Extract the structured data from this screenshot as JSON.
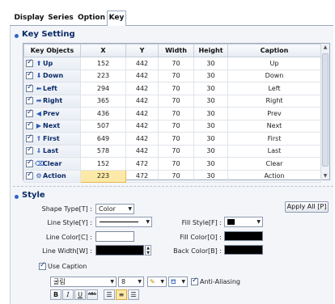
{
  "tabs": [
    {
      "label": "Display",
      "active": false
    },
    {
      "label": "Series",
      "active": false
    },
    {
      "label": "Option",
      "active": false
    },
    {
      "label": "Key",
      "active": true
    }
  ],
  "key_setting": {
    "title": "Key Setting",
    "columns": [
      "Key Objects",
      "X",
      "Y",
      "Width",
      "Height",
      "Caption"
    ],
    "rows": [
      {
        "icon": "arrow-up-icon",
        "name": "Up",
        "x": "152",
        "y": "442",
        "width": "70",
        "height": "30",
        "caption": "Up",
        "checked": true,
        "selected": false
      },
      {
        "icon": "arrow-down-icon",
        "name": "Down",
        "x": "223",
        "y": "442",
        "width": "70",
        "height": "30",
        "caption": "Down",
        "checked": true,
        "selected": false
      },
      {
        "icon": "arrow-left-icon",
        "name": "Left",
        "x": "294",
        "y": "442",
        "width": "70",
        "height": "30",
        "caption": "Left",
        "checked": true,
        "selected": false
      },
      {
        "icon": "arrow-right-icon",
        "name": "Right",
        "x": "365",
        "y": "442",
        "width": "70",
        "height": "30",
        "caption": "Right",
        "checked": true,
        "selected": false
      },
      {
        "icon": "prev-icon",
        "name": "Prev",
        "x": "436",
        "y": "442",
        "width": "70",
        "height": "30",
        "caption": "Prev",
        "checked": true,
        "selected": false
      },
      {
        "icon": "next-icon",
        "name": "Next",
        "x": "507",
        "y": "442",
        "width": "70",
        "height": "30",
        "caption": "Next",
        "checked": true,
        "selected": false
      },
      {
        "icon": "first-icon",
        "name": "First",
        "x": "649",
        "y": "442",
        "width": "70",
        "height": "30",
        "caption": "First",
        "checked": true,
        "selected": false
      },
      {
        "icon": "last-icon",
        "name": "Last",
        "x": "578",
        "y": "442",
        "width": "70",
        "height": "30",
        "caption": "Last",
        "checked": true,
        "selected": false
      },
      {
        "icon": "clear-icon",
        "name": "Clear",
        "x": "152",
        "y": "472",
        "width": "70",
        "height": "30",
        "caption": "Clear",
        "checked": true,
        "selected": false
      },
      {
        "icon": "action-icon",
        "name": "Action",
        "x": "223",
        "y": "472",
        "width": "70",
        "height": "30",
        "caption": "Action",
        "checked": true,
        "selected": true
      }
    ]
  },
  "style": {
    "title": "Style",
    "apply_all": "Apply All [P]",
    "shape_type_label": "Shape Type[T] :",
    "shape_type_value": "Color",
    "line_style_label": "Line Style[Y] :",
    "line_color_label": "Line Color[C] :",
    "line_color": "#ffffff",
    "line_width_label": "Line Width[W] :",
    "fill_style_label": "Fill Style[F] :",
    "fill_style_color": "#000000",
    "fill_color_label": "Fill Color[O] :",
    "fill_color": "#000000",
    "back_color_label": "Back Color[B] :",
    "back_color": "#000000",
    "use_caption_label": "Use Caption",
    "use_caption_checked": true,
    "font_name": "굴림",
    "font_size": "8",
    "anti_aliasing_label": "Anti-Aliasing",
    "anti_aliasing_checked": true,
    "format_buttons": [
      "B",
      "I",
      "U",
      "ABC"
    ]
  }
}
